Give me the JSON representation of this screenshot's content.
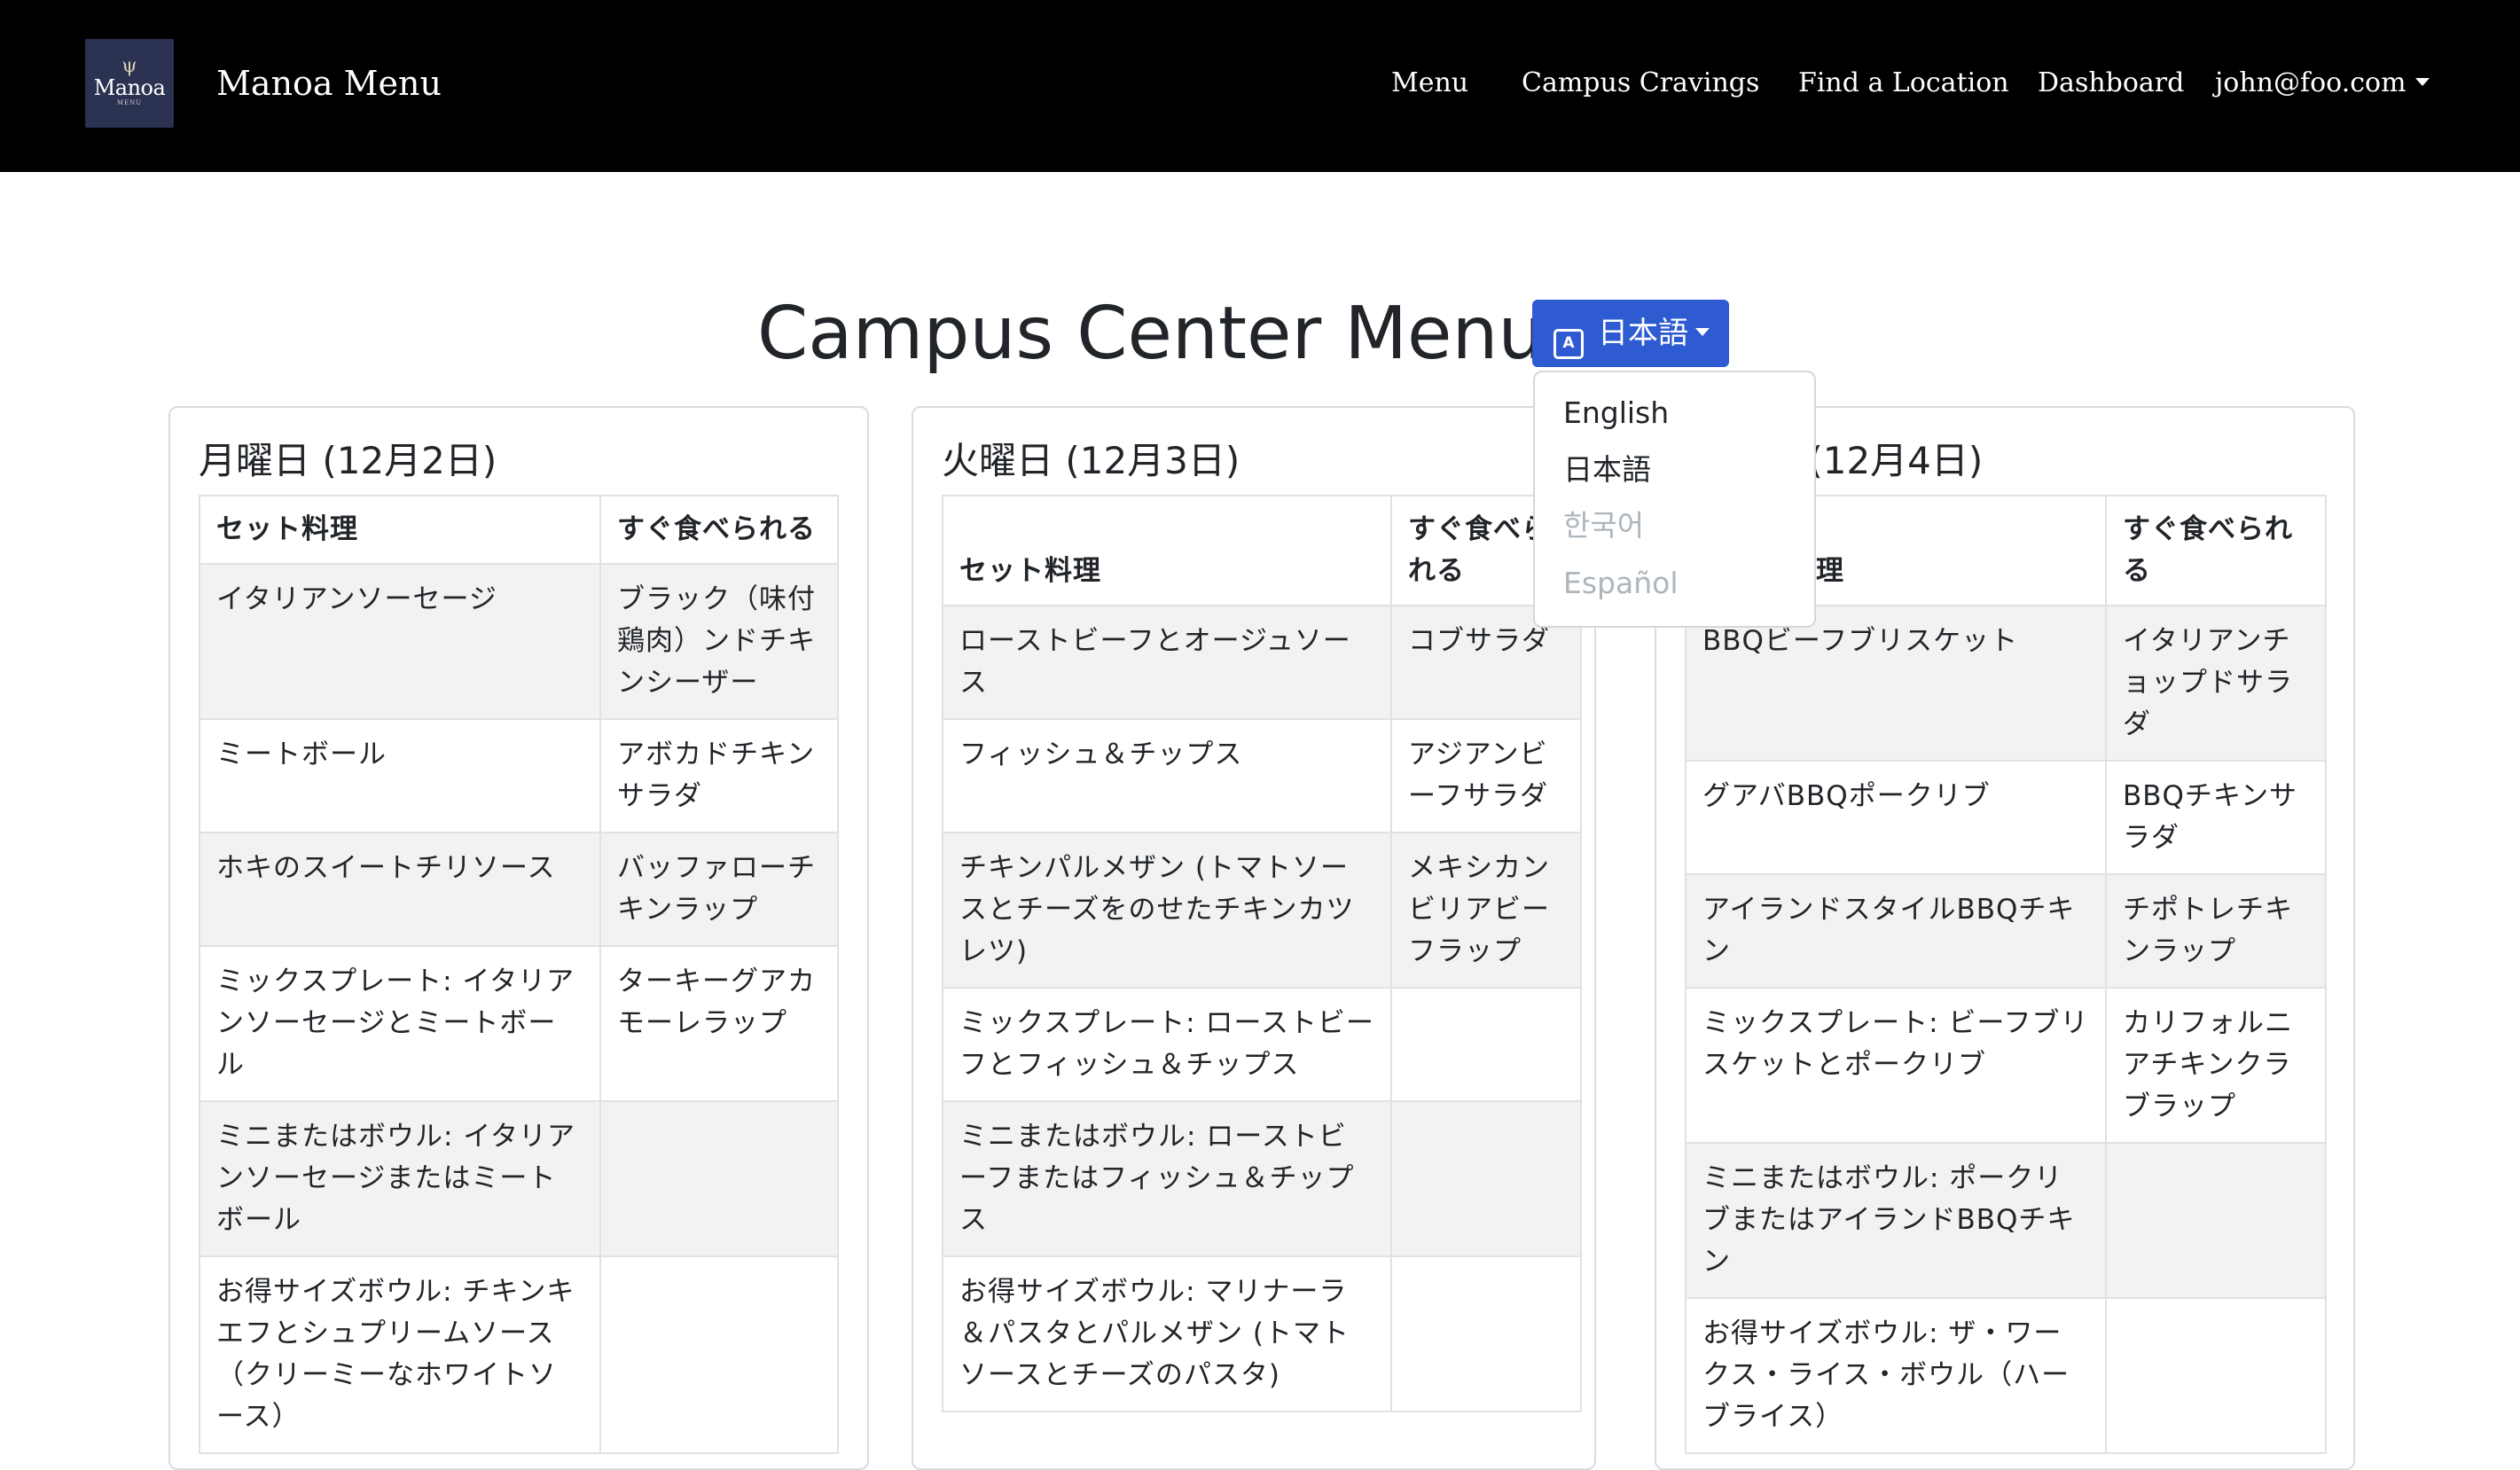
{
  "navbar": {
    "logo": {
      "word": "Manoa",
      "sub": "MENU"
    },
    "brand_title": "Manoa Menu",
    "links": {
      "menu": "Menu",
      "cravings": "Campus Cravings",
      "location": "Find a Location",
      "dashboard": "Dashboard",
      "user": "john@foo.com"
    }
  },
  "page": {
    "title": "Campus Center Menu",
    "language_button": "日本語",
    "language_icon": "translate-icon",
    "language_options": [
      "English",
      "日本語",
      "한국어",
      "Español"
    ],
    "accent_color": "#2f5bd2"
  },
  "days": [
    {
      "title": "月曜日 (12月2日)",
      "headers": [
        "セット料理",
        "すぐ食べられる"
      ],
      "rows": [
        [
          "イタリアンソーセージ",
          "ブラック（味付鶏肉）ンドチキンシーザー"
        ],
        [
          "ミートボール",
          "アボカドチキンサラダ"
        ],
        [
          "ホキのスイートチリソース",
          "バッファローチキンラップ"
        ],
        [
          "ミックスプレート: イタリアンソーセージとミートボール",
          "ターキーグアカモーレラップ"
        ],
        [
          "ミニまたはボウル: イタリアンソーセージまたはミートボール",
          ""
        ],
        [
          "お得サイズボウル: チキンキエフとシュプリームソース（クリーミーなホワイトソース）",
          ""
        ]
      ]
    },
    {
      "title": "火曜日 (12月3日)",
      "headers": [
        "セット料理",
        "すぐ食べられる"
      ],
      "rows": [
        [
          "ローストビーフとオージュソース",
          "コブサラダ"
        ],
        [
          "フィッシュ＆チップス",
          "アジアンビーフサラダ"
        ],
        [
          "チキンパルメザン (トマトソースとチーズをのせたチキンカツレツ)",
          "メキシカンビリアビーフラップ"
        ],
        [
          "ミックスプレート: ローストビーフとフィッシュ＆チップス",
          ""
        ],
        [
          "ミニまたはボウル: ローストビーフまたはフィッシュ＆チップス",
          ""
        ],
        [
          "お得サイズボウル: マリナーラ＆パスタとパルメザン (トマトソースとチーズのパスタ)",
          ""
        ]
      ]
    },
    {
      "title": "水曜日 (12月4日)",
      "headers": [
        "セット料理",
        "すぐ食べられる"
      ],
      "rows": [
        [
          "BBQビーフブリスケット",
          "イタリアンチョップドサラダ"
        ],
        [
          "グアバBBQポークリブ",
          "BBQチキンサラダ"
        ],
        [
          "アイランドスタイルBBQチキン",
          "チポトレチキンラップ"
        ],
        [
          "ミックスプレート: ビーフブリスケットとポークリブ",
          "カリフォルニアチキンクラブラップ"
        ],
        [
          "ミニまたはボウル: ポークリブまたはアイランドBBQチキン",
          ""
        ],
        [
          "お得サイズボウル: ザ・ワークス・ライス・ボウル（ハーブライス）",
          ""
        ]
      ]
    }
  ]
}
